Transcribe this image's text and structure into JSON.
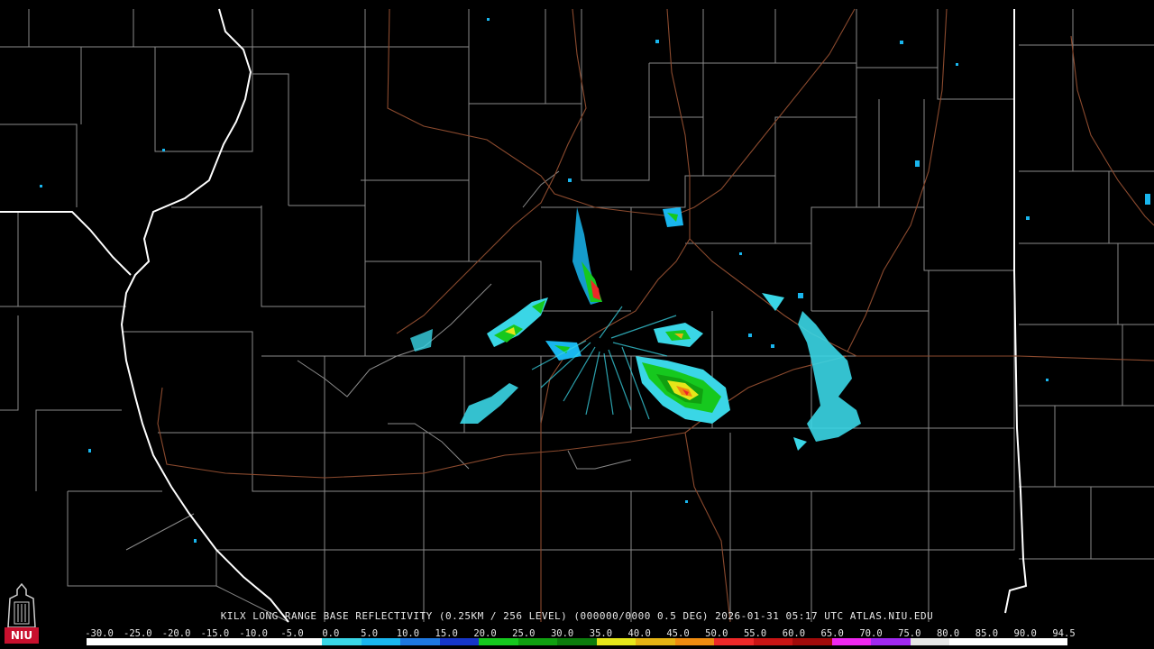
{
  "radar": {
    "caption": "KILX LONG RANGE BASE REFLECTIVITY (0.25KM / 256 LEVEL) (000000/0000 0.5 DEG) 2026-01-31 05:17 UTC  ATLAS.NIU.EDU",
    "station": "KILX",
    "product": "LONG RANGE BASE REFLECTIVITY",
    "timestamp": "2026-01-31 05:17 UTC",
    "source": "ATLAS.NIU.EDU"
  },
  "logo": {
    "text": "NIU",
    "icon": "niu-tower-logo-icon"
  },
  "colorscale": {
    "ticks": [
      "-30.0",
      "-25.0",
      "-20.0",
      "-15.0",
      "-10.0",
      "-5.0",
      "0.0",
      "5.0",
      "10.0",
      "15.0",
      "20.0",
      "25.0",
      "30.0",
      "35.0",
      "40.0",
      "45.0",
      "50.0",
      "55.0",
      "60.0",
      "65.0",
      "70.0",
      "75.0",
      "80.0",
      "85.0",
      "90.0",
      "94.5"
    ],
    "colors": [
      "#ffffff",
      "#ffffff",
      "#ffffff",
      "#ffffff",
      "#ffffff",
      "#ffffff",
      "#3ad6e6",
      "#19b6ee",
      "#1e78e0",
      "#1636c8",
      "#16c81e",
      "#10a010",
      "#0c7c0c",
      "#e6e61a",
      "#e6b414",
      "#f08c10",
      "#ee2828",
      "#c81414",
      "#a00a0a",
      "#f028f0",
      "#a028f0",
      "#e6e6e6",
      "#ffffff",
      "#ffffff",
      "#ffffff"
    ],
    "colors_meaning": "bands from -30 to 94.5 dBZ; near-white low values, cyan/blue 0-15, greens 20-30, yellow/orange 35-45, reds 50-60, magentas 65-70, white 75+"
  },
  "map_colors": {
    "background": "#000000",
    "county_lines": "#8a8a8a",
    "state_lines": "#ffffff",
    "highways": "#8b4a2e"
  }
}
